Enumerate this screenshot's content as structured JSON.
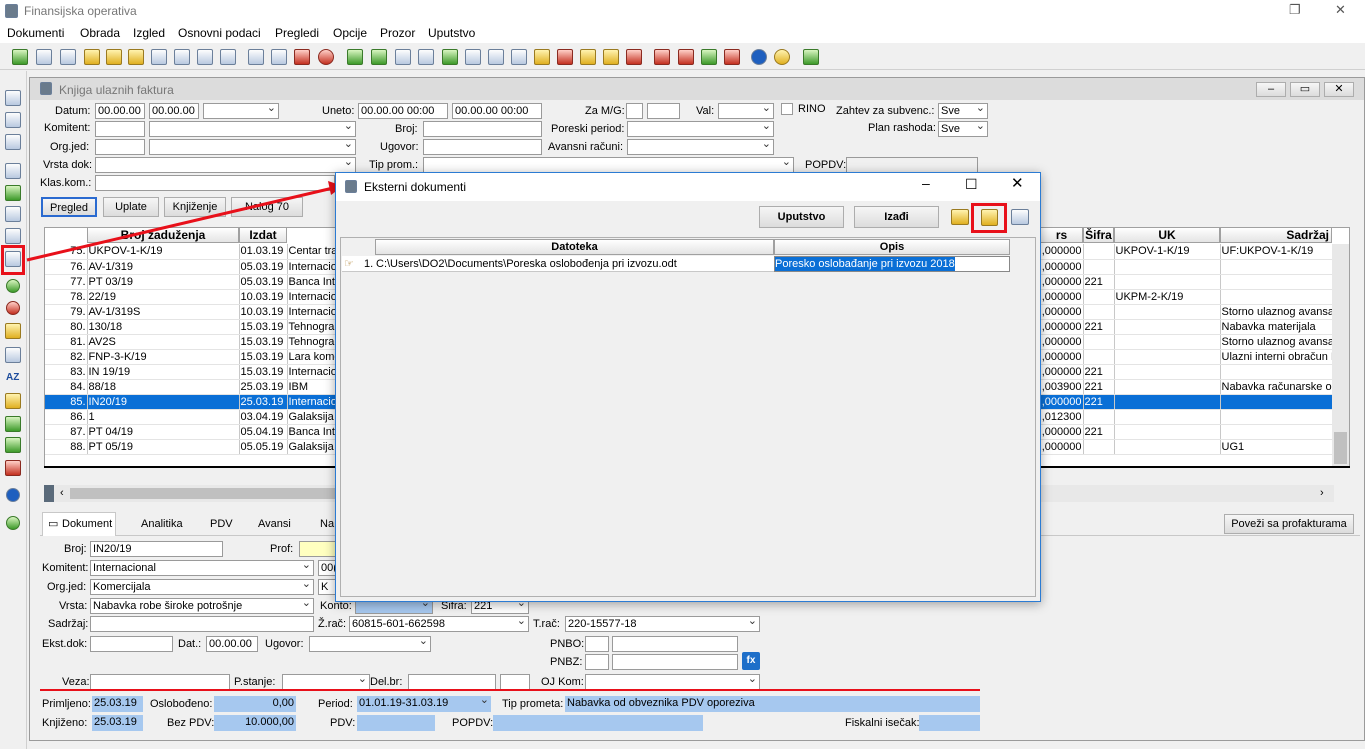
{
  "app": {
    "title": "Finansijska operativa",
    "win_restore": "❐",
    "win_close": "✕"
  },
  "menu": [
    "Dokumenti",
    "Obrada",
    "Izgled",
    "Osnovni podaci",
    "Pregledi",
    "Opcije",
    "Prozor",
    "Uputstvo"
  ],
  "child": {
    "title": "Knjiga ulaznih faktura"
  },
  "filters": {
    "datum_label": "Datum:",
    "datum_from": "00.00.00",
    "datum_to": "00.00.00",
    "uneto_label": "Uneto:",
    "uneto_from": "00.00.00 00:00",
    "uneto_to": "00.00.00 00:00",
    "zamg_label": "Za M/G:",
    "val_label": "Val:",
    "rino_label": "RINO",
    "subvenc_label": "Zahtev za subvenc.:",
    "subvenc_value": "Sve",
    "plan_label": "Plan rashoda:",
    "plan_value": "Sve",
    "komitent_label": "Komitent:",
    "broj_label": "Broj:",
    "poreski_label": "Poreski period:",
    "orgjed_label": "Org.jed:",
    "ugovor_label": "Ugovor:",
    "avansni_label": "Avansni računi:",
    "vrsta_label": "Vrsta dok:",
    "tipprom_label": "Tip prom.:",
    "popdv_label": "POPDV:",
    "klas_label": "Klas.kom.:"
  },
  "tabs": [
    "Pregled",
    "Uplate",
    "Knjiženje",
    "Nalog 70"
  ],
  "grid": {
    "col_broj": "Broj zaduženja",
    "col_izdat": "Izdat",
    "col_rs": "rs",
    "col_sifra": "Šifra",
    "col_uk": "UK",
    "col_sadrzaj": "Sadržaj",
    "rows": [
      {
        "n": "75.",
        "broj": "UKPOV-1-K/19",
        "izdat": "01.03.19",
        "kom": "Centar tra",
        "iznos": ",000000",
        "sifra": "",
        "uk": "UKPOV-1-K/19",
        "sad": "UF:UKPOV-1-K/19"
      },
      {
        "n": "76.",
        "broj": "AV-1/319",
        "izdat": "05.03.19",
        "kom": "Internacio",
        "iznos": ",000000",
        "sifra": "",
        "uk": "",
        "sad": ""
      },
      {
        "n": "77.",
        "broj": "PT 03/19",
        "izdat": "05.03.19",
        "kom": "Banca Int",
        "iznos": ",000000",
        "sifra": "221",
        "uk": "",
        "sad": ""
      },
      {
        "n": "78.",
        "broj": "22/19",
        "izdat": "10.03.19",
        "kom": "Internacio",
        "iznos": ",000000",
        "sifra": "",
        "uk": "UKPM-2-K/19",
        "sad": ""
      },
      {
        "n": "79.",
        "broj": "AV-1/319S",
        "izdat": "10.03.19",
        "kom": "Internacio",
        "iznos": ",000000",
        "sifra": "",
        "uk": "",
        "sad": "Storno ulaznog avansa"
      },
      {
        "n": "80.",
        "broj": "130/18",
        "izdat": "15.03.19",
        "kom": "Tehnogra",
        "iznos": ",000000",
        "sifra": "221",
        "uk": "",
        "sad": "Nabavka materijala"
      },
      {
        "n": "81.",
        "broj": "AV2S",
        "izdat": "15.03.19",
        "kom": "Tehnogra",
        "iznos": ",000000",
        "sifra": "",
        "uk": "",
        "sad": "Storno ulaznog avansa"
      },
      {
        "n": "82.",
        "broj": "FNP-3-K/19",
        "izdat": "15.03.19",
        "kom": "Lara kome",
        "iznos": ",000000",
        "sifra": "",
        "uk": "",
        "sad": "Ulazni interni obračun P"
      },
      {
        "n": "83.",
        "broj": "IN 19/19",
        "izdat": "15.03.19",
        "kom": "Internacio",
        "iznos": ",000000",
        "sifra": "221",
        "uk": "",
        "sad": ""
      },
      {
        "n": "84.",
        "broj": "88/18",
        "izdat": "25.03.19",
        "kom": "IBM",
        "iznos": ",003900",
        "sifra": "221",
        "uk": "",
        "sad": "Nabavka računarske op"
      },
      {
        "n": "85.",
        "broj": "IN20/19",
        "izdat": "25.03.19",
        "kom": "Internacio",
        "iznos": ",000000",
        "sifra": "221",
        "uk": "",
        "sad": ""
      },
      {
        "n": "86.",
        "broj": "1",
        "izdat": "03.04.19",
        "kom": "Galaksija",
        "iznos": ",012300",
        "sifra": "",
        "uk": "",
        "sad": ""
      },
      {
        "n": "87.",
        "broj": "PT 04/19",
        "izdat": "05.04.19",
        "kom": "Banca Int",
        "iznos": ",000000",
        "sifra": "221",
        "uk": "",
        "sad": ""
      },
      {
        "n": "88.",
        "broj": "PT 05/19",
        "izdat": "05.05.19",
        "kom": "Galaksija",
        "iznos": ",000000",
        "sifra": "",
        "uk": "",
        "sad": "UG1"
      }
    ]
  },
  "bottom_tabs": [
    "Dokument",
    "Analitika",
    "PDV",
    "Avansi",
    "Na"
  ],
  "povezi": "Poveži sa profakturama",
  "form": {
    "broj_label": "Broj:",
    "broj": "IN20/19",
    "prof_label": "Prof:",
    "komitent_label": "Komitent:",
    "komitent": "Internacional",
    "komitent_code": "00(",
    "orgjed_label": "Org.jed:",
    "orgjed": "Komercijala",
    "orgjed_code": "K",
    "vrsta_label": "Vrsta:",
    "vrsta": "Nabavka robe široke potrošnje",
    "konto_label": "Konto:",
    "sifra_label": "Šifra:",
    "sifra": "221",
    "sadrzaj_label": "Sadržaj:",
    "zrac_label": "Ž.rač:",
    "zrac": "60815-601-662598",
    "trac_label": "T.rač:",
    "trac": "220-15577-18",
    "ekst_label": "Ekst.dok:",
    "dat_label": "Dat.:",
    "dat": "00.00.00",
    "ugovor_label": "Ugovor:",
    "pnbo_label": "PNBO:",
    "pnbz_label": "PNBZ:",
    "veza_label": "Veza:",
    "pstanje_label": "P.stanje:",
    "delbr_label": "Del.br:",
    "ojkom_label": "OJ Kom:",
    "primljeno_label": "Primljeno:",
    "primljeno": "25.03.19",
    "oslobodjeno_label": "Oslobođeno:",
    "oslobodjeno": "0,00",
    "period_label": "Period:",
    "period": "01.01.19-31.03.19",
    "tipprometa_label": "Tip prometa:",
    "tipprometa": "Nabavka od obveznika PDV oporeziva",
    "knjizeno_label": "Knjiženo:",
    "knjizeno": "25.03.19",
    "bezpdv_label": "Bez PDV:",
    "bezpdv": "10.000,00",
    "pdv_label": "PDV:",
    "popdv_label": "POPDV:",
    "fiskalni_label": "Fiskalni isečak:"
  },
  "dialog": {
    "title": "Eksterni dokumenti",
    "uputstvo": "Uputstvo",
    "izadji": "Izađi",
    "col_datoteka": "Datoteka",
    "col_opis": "Opis",
    "row_n": "1.",
    "row_file": "C:\\Users\\DO2\\Documents\\Poreska oslobođenja pri izvozu.odt",
    "row_opis": "Poresko oslobađanje pri izvozu 2018"
  },
  "colors": {
    "accent": "#0a6fd6",
    "highlight_red": "#e8101a",
    "selection_blue": "#a6c8ef"
  }
}
